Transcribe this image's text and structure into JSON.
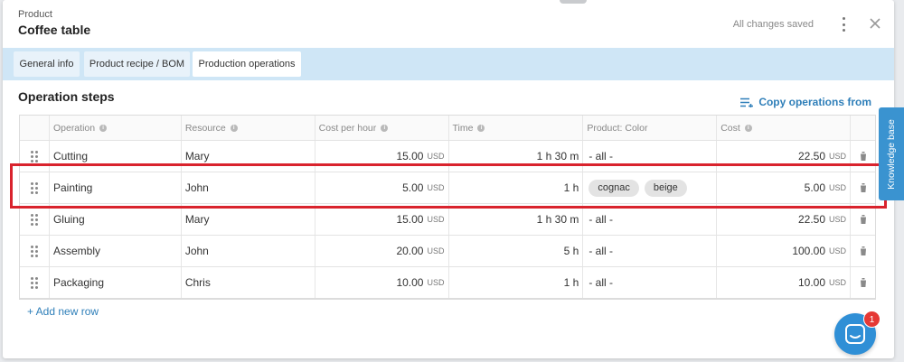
{
  "header": {
    "label": "Product",
    "title": "Coffee table",
    "status": "All changes saved",
    "more_icon": "kebab-icon",
    "close_icon": "close-icon"
  },
  "tabs": [
    {
      "label": "General info",
      "active": false
    },
    {
      "label": "Product recipe / BOM",
      "active": false
    },
    {
      "label": "Production operations",
      "active": true
    }
  ],
  "section": {
    "title": "Operation steps",
    "copy_label": "Copy operations from"
  },
  "table": {
    "columns": [
      "Operation",
      "Resource",
      "Cost per hour",
      "Time",
      "Product: Color",
      "Cost"
    ],
    "rows": [
      {
        "operation": "Cutting",
        "resource": "Mary",
        "cost_per_hour": "15.00",
        "cph_unit": "USD",
        "time": "1 h 30 m",
        "color": "- all -",
        "tags": [],
        "cost": "22.50",
        "cost_unit": "USD"
      },
      {
        "operation": "Painting",
        "resource": "John",
        "cost_per_hour": "5.00",
        "cph_unit": "USD",
        "time": "1 h",
        "color": "",
        "tags": [
          "cognac",
          "beige"
        ],
        "cost": "5.00",
        "cost_unit": "USD"
      },
      {
        "operation": "Gluing",
        "resource": "Mary",
        "cost_per_hour": "15.00",
        "cph_unit": "USD",
        "time": "1 h 30 m",
        "color": "- all -",
        "tags": [],
        "cost": "22.50",
        "cost_unit": "USD"
      },
      {
        "operation": "Assembly",
        "resource": "John",
        "cost_per_hour": "20.00",
        "cph_unit": "USD",
        "time": "5 h",
        "color": "- all -",
        "tags": [],
        "cost": "100.00",
        "cost_unit": "USD"
      },
      {
        "operation": "Packaging",
        "resource": "Chris",
        "cost_per_hour": "10.00",
        "cph_unit": "USD",
        "time": "1 h",
        "color": "- all -",
        "tags": [],
        "cost": "10.00",
        "cost_unit": "USD"
      }
    ]
  },
  "add_row_label": "+ Add new row",
  "knowledge_base_label": "Knowledge base",
  "chat": {
    "badge_count": "1"
  },
  "colors": {
    "accent": "#2f7fb9",
    "tabbar": "#cfe6f6",
    "highlight": "#d9232d",
    "badge": "#e53935"
  }
}
